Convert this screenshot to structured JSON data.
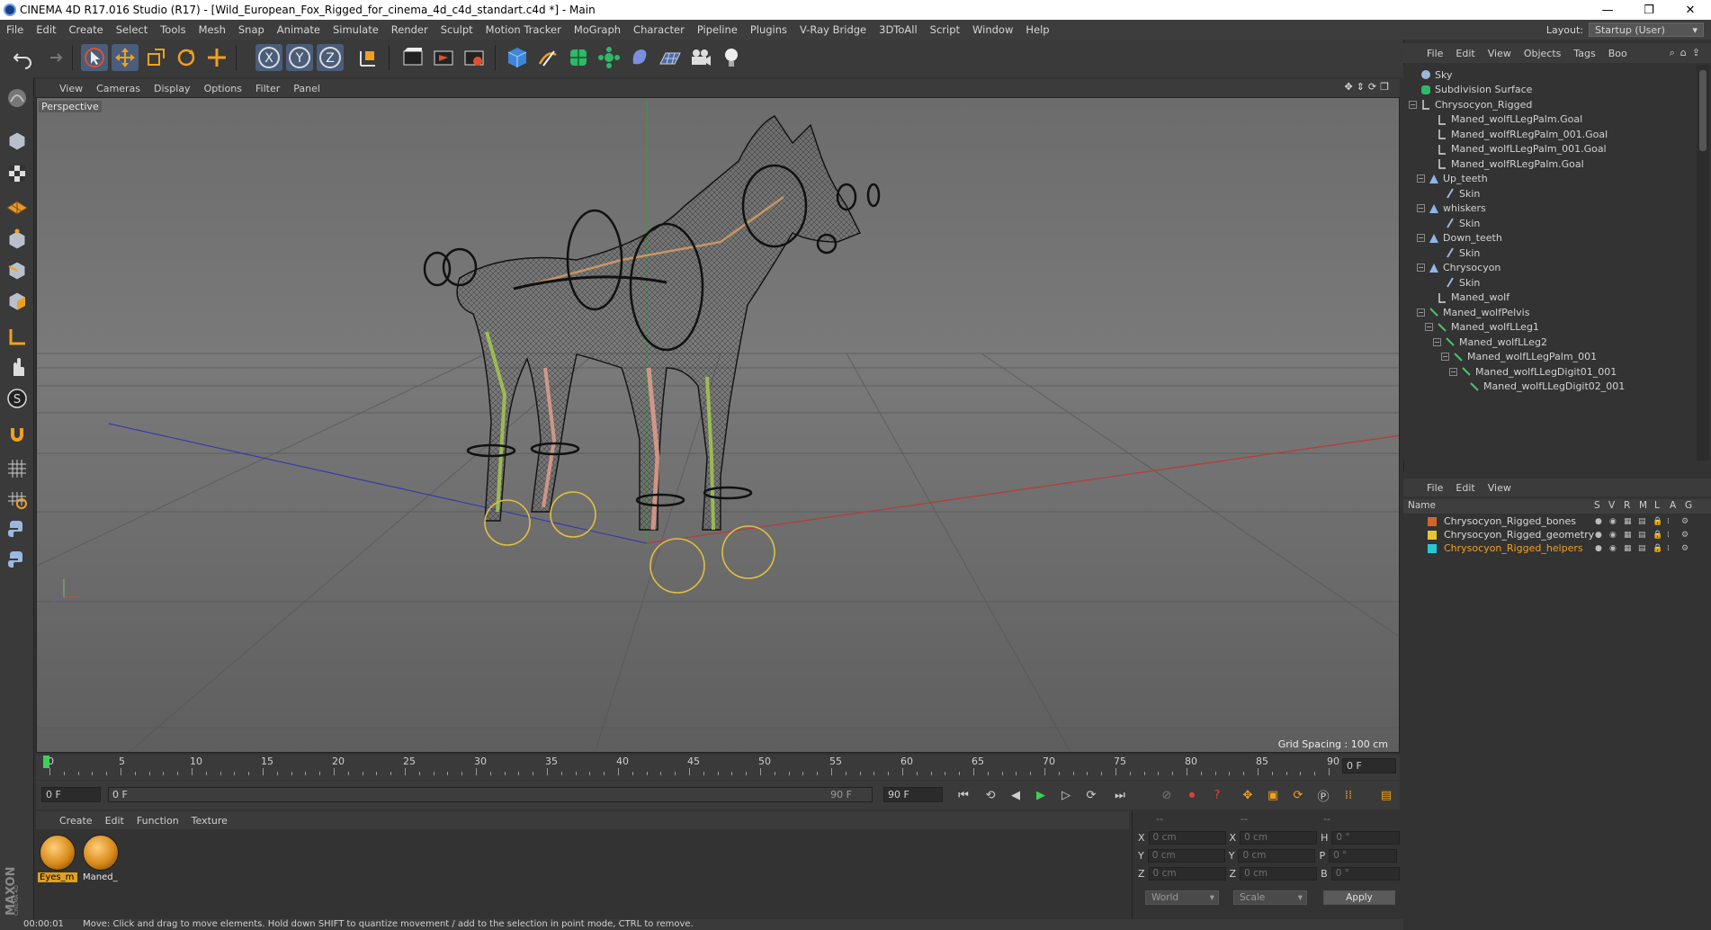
{
  "window": {
    "title": "CINEMA 4D R17.016 Studio (R17) - [Wild_European_Fox_Rigged_for_cinema_4d_c4d_standart.c4d *] - Main",
    "controls": [
      "—",
      "❐",
      "✕"
    ]
  },
  "menubar": {
    "items": [
      "File",
      "Edit",
      "Create",
      "Select",
      "Tools",
      "Mesh",
      "Snap",
      "Animate",
      "Simulate",
      "Render",
      "Sculpt",
      "Motion Tracker",
      "MoGraph",
      "Character",
      "Pipeline",
      "Plugins",
      "V-Ray Bridge",
      "3DToAll",
      "Script",
      "Window",
      "Help"
    ],
    "layout_label": "Layout:",
    "layout_value": "Startup (User)"
  },
  "toolbar": {
    "icons": [
      "undo-icon",
      "redo-icon",
      "select-icon",
      "move-icon",
      "scale-icon",
      "rotate-icon",
      "move-alt-icon",
      "x-axis-icon",
      "y-axis-icon",
      "z-axis-icon",
      "coordinate-system-icon",
      "render-view-icon",
      "render-picture-icon",
      "render-settings-icon",
      "cube-icon",
      "pen-icon",
      "subdivision-icon",
      "cloner-icon",
      "deformer-icon",
      "floor-icon",
      "camera-icon",
      "light-icon"
    ],
    "axis_labels": [
      "X",
      "Y",
      "Z"
    ]
  },
  "viewport": {
    "menu": [
      "View",
      "Cameras",
      "Display",
      "Options",
      "Filter",
      "Panel"
    ],
    "label": "Perspective",
    "grid_spacing": "Grid Spacing : 100 cm"
  },
  "timeline": {
    "ticks": [
      "0",
      "5",
      "10",
      "15",
      "20",
      "25",
      "30",
      "35",
      "40",
      "45",
      "50",
      "55",
      "60",
      "65",
      "70",
      "75",
      "80",
      "85",
      "90"
    ],
    "current_frame": "0 F",
    "start_field": "0 F",
    "range_start": "0 F",
    "range_end": "90 F",
    "end_field": "90 F"
  },
  "material_manager": {
    "menu": [
      "Create",
      "Edit",
      "Function",
      "Texture"
    ],
    "materials": [
      {
        "label": "Eyes_m",
        "selected": true
      },
      {
        "label": "Maned_",
        "selected": false
      }
    ]
  },
  "coordinates": {
    "header": [
      "--",
      "--",
      "--"
    ],
    "rows": [
      {
        "a": "X",
        "av": "0 cm",
        "b": "X",
        "bv": "0 cm",
        "c": "H",
        "cv": "0 °"
      },
      {
        "a": "Y",
        "av": "0 cm",
        "b": "Y",
        "bv": "0 cm",
        "c": "P",
        "cv": "0 °"
      },
      {
        "a": "Z",
        "av": "0 cm",
        "b": "Z",
        "bv": "0 cm",
        "c": "B",
        "cv": "0 °"
      }
    ],
    "mode": "World",
    "scale": "Scale",
    "apply": "Apply"
  },
  "status": {
    "time": "00:00:01",
    "message": "Move: Click and drag to move elements. Hold down SHIFT to quantize movement / add to the selection in point mode, CTRL to remove."
  },
  "object_manager": {
    "menu": [
      "File",
      "Edit",
      "View",
      "Objects",
      "Tags",
      "Boo"
    ],
    "items": [
      {
        "label": "Sky",
        "indent": 0,
        "icon": "sky-icon",
        "color": "#8bb3d8"
      },
      {
        "label": "Subdivision Surface",
        "indent": 0,
        "icon": "subdivision-icon",
        "color": "#5fd06a"
      },
      {
        "label": "Chrysocyon_Rigged",
        "indent": 0,
        "icon": "null-icon",
        "color": "#d0d0d0"
      },
      {
        "label": "Maned_wolfLLegPalm.Goal",
        "indent": 2,
        "icon": "null-icon",
        "color": "#d0d0d0"
      },
      {
        "label": "Maned_wolfRLegPalm_001.Goal",
        "indent": 2,
        "icon": "null-icon",
        "color": "#d0d0d0"
      },
      {
        "label": "Maned_wolfLLegPalm_001.Goal",
        "indent": 2,
        "icon": "null-icon",
        "color": "#d0d0d0"
      },
      {
        "label": "Maned_wolfRLegPalm.Goal",
        "indent": 2,
        "icon": "null-icon",
        "color": "#d0d0d0"
      },
      {
        "label": "Up_teeth",
        "indent": 1,
        "icon": "polygon-icon",
        "color": "#8fb6ea"
      },
      {
        "label": "Skin",
        "indent": 3,
        "icon": "skin-icon",
        "color": "#9ab6e0"
      },
      {
        "label": "whiskers",
        "indent": 1,
        "icon": "polygon-icon",
        "color": "#8fb6ea"
      },
      {
        "label": "Skin",
        "indent": 3,
        "icon": "skin-icon",
        "color": "#9ab6e0"
      },
      {
        "label": "Down_teeth",
        "indent": 1,
        "icon": "polygon-icon",
        "color": "#8fb6ea"
      },
      {
        "label": "Skin",
        "indent": 3,
        "icon": "skin-icon",
        "color": "#9ab6e0"
      },
      {
        "label": "Chrysocyon",
        "indent": 1,
        "icon": "polygon-icon",
        "color": "#8fb6ea"
      },
      {
        "label": "Skin",
        "indent": 3,
        "icon": "skin-icon",
        "color": "#9ab6e0"
      },
      {
        "label": "Maned_wolf",
        "indent": 2,
        "icon": "null-icon",
        "color": "#d0d0d0"
      },
      {
        "label": "Maned_wolfPelvis",
        "indent": 1,
        "icon": "joint-icon",
        "color": "#4fc06a"
      },
      {
        "label": "Maned_wolfLLeg1",
        "indent": 2,
        "icon": "joint-icon",
        "color": "#4fc06a"
      },
      {
        "label": "Maned_wolfLLeg2",
        "indent": 3,
        "icon": "joint-icon",
        "color": "#4fc06a"
      },
      {
        "label": "Maned_wolfLLegPalm_001",
        "indent": 4,
        "icon": "joint-icon",
        "color": "#4fc06a"
      },
      {
        "label": "Maned_wolfLLegDigit01_001",
        "indent": 5,
        "icon": "joint-icon",
        "color": "#4fc06a"
      },
      {
        "label": "Maned_wolfLLegDigit02_001",
        "indent": 6,
        "icon": "joint-icon",
        "color": "#4fc06a"
      }
    ]
  },
  "layer_manager": {
    "menu": [
      "File",
      "Edit",
      "View"
    ],
    "columns": [
      "Name",
      "S",
      "V",
      "R",
      "M",
      "L",
      "A",
      "G"
    ],
    "layers": [
      {
        "name": "Chrysocyon_Rigged_bones",
        "color": "#d8632a",
        "text_color": "#d8d8d8"
      },
      {
        "name": "Chrysocyon_Rigged_geometry",
        "color": "#e2c830",
        "text_color": "#d8d8d8"
      },
      {
        "name": "Chrysocyon_Rigged_helpers",
        "color": "#26c8d8",
        "text_color": "#f0a020"
      }
    ]
  }
}
